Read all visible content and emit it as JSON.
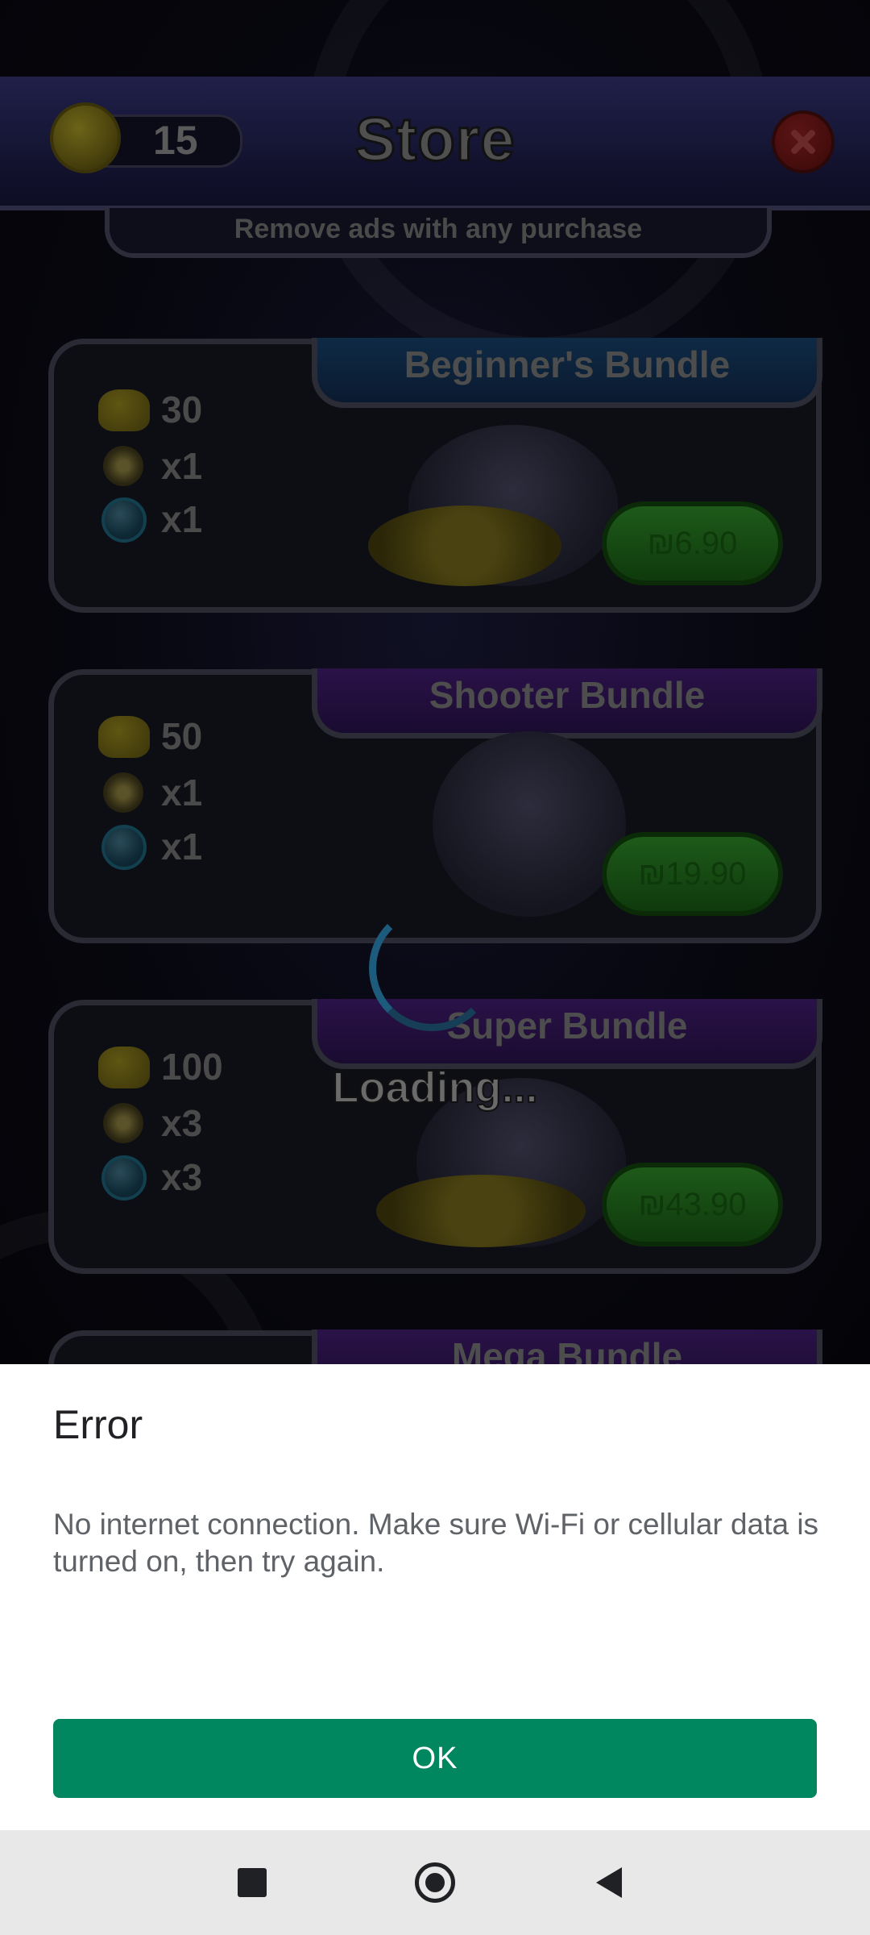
{
  "store": {
    "coin_balance": "15",
    "title": "Store",
    "banner": "Remove ads with any purchase"
  },
  "bundles": [
    {
      "name": "Beginner's Bundle",
      "coins": "30",
      "item2": "x1",
      "item3": "x1",
      "price": "₪6.90",
      "tab_color": "#0f2a45"
    },
    {
      "name": "Shooter Bundle",
      "coins": "50",
      "item2": "x1",
      "item3": "x1",
      "price": "₪19.90",
      "tab_color": "#2a1248"
    },
    {
      "name": "Super Bundle",
      "coins": "100",
      "item2": "x3",
      "item3": "x3",
      "price": "₪43.90",
      "tab_color": "#2a1248"
    },
    {
      "name": "Mega Bundle"
    }
  ],
  "loading": {
    "text": "Loading..."
  },
  "dialog": {
    "title": "Error",
    "message": "No internet connection. Make sure Wi-Fi or cellular data is turned on, then try again.",
    "ok_label": "OK",
    "ok_color": "#01875f"
  },
  "navbar": {
    "icons": [
      "recents-square-icon",
      "home-circle-icon",
      "back-triangle-icon"
    ]
  }
}
